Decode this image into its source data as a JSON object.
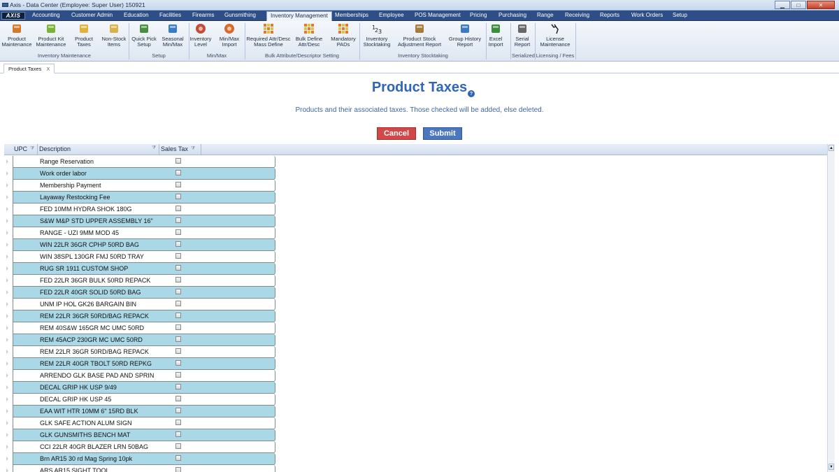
{
  "window": {
    "title": "Axis - Data Center  (Employee: Super User) 150921",
    "minimize_glyph": "▁",
    "maximize_glyph": "□",
    "close_glyph": "✕"
  },
  "menu": {
    "logo": "AXIS",
    "items": [
      "Accounting",
      "Customer Admin",
      "Education",
      "Facilities",
      "Firearms",
      "Gunsmithing",
      "Inventory Management",
      "Memberships",
      "Employee",
      "POS Management",
      "Pricing",
      "Purchasing",
      "Range",
      "Receiving",
      "Reports",
      "Work Orders",
      "Setup"
    ],
    "active": "Inventory Management"
  },
  "ribbon": {
    "buttons": [
      {
        "line1": "Product",
        "line2": "Maintenance",
        "icon": "box-icon"
      },
      {
        "line1": "Product Kit",
        "line2": "Maintenance",
        "icon": "puzzle-icon"
      },
      {
        "line1": "Product",
        "line2": "Taxes",
        "icon": "coins-icon"
      },
      {
        "line1": "Non-Stock",
        "line2": "Items",
        "icon": "package-icon"
      },
      {
        "line1": "Quick Pick",
        "line2": "Setup",
        "icon": "quickpick-icon"
      },
      {
        "line1": "Seasonal",
        "line2": "Min/Max",
        "icon": "seasonal-icon"
      },
      {
        "line1": "Inventory",
        "line2": "Level",
        "icon": "gauge-icon"
      },
      {
        "line1": "Min/Max",
        "line2": "Import",
        "icon": "import-icon"
      },
      {
        "line1": "Required Attr/Desc",
        "line2": "Mass Define",
        "icon": "grid-icon"
      },
      {
        "line1": "Bulk Define",
        "line2": "Attr/Desc",
        "icon": "grid-icon"
      },
      {
        "line1": "Mandatory",
        "line2": "PADs",
        "icon": "grid-icon"
      },
      {
        "line1": "Inventory",
        "line2": "Stocktaking",
        "icon": "numbers-icon"
      },
      {
        "line1": "Product Stock",
        "line2": "Adjustment Report",
        "icon": "clipboard-icon"
      },
      {
        "line1": "Group History",
        "line2": "Report",
        "icon": "download-icon"
      },
      {
        "line1": "Excel",
        "line2": "Import",
        "icon": "excel-icon"
      },
      {
        "line1": "Serial",
        "line2": "Report",
        "icon": "report-icon"
      },
      {
        "line1": "License",
        "line2": "Maintenance",
        "icon": "deer-icon"
      }
    ],
    "groups": [
      "Inventory Maintenance",
      "Setup",
      "Min/Max",
      "Bulk Attribute/Descriptor Setting",
      "Inventory Stocktaking",
      "Serialized",
      "Licensing / Fees"
    ]
  },
  "tab": {
    "label": "Product Taxes",
    "close": "X"
  },
  "page": {
    "title": "Product Taxes",
    "help": "?",
    "subtitle": "Products and their associated taxes.  Those checked will be added, else deleted.",
    "cancel": "Cancel",
    "submit": "Submit"
  },
  "grid": {
    "columns": [
      "UPC",
      "Description",
      "Sales Tax"
    ],
    "rows": [
      "Range Reservation",
      "Work order labor",
      "Membership Payment",
      "Layaway Restocking Fee",
      "FED 10MM HYDRA SHOK 180G",
      "S&W M&P STD UPPER ASSEMBLY 16\"",
      "RANGE - UZI 9MM MOD 45",
      "WIN 22LR 36GR CPHP 50RD BAG",
      "WIN 38SPL 130GR FMJ 50RD TRAY",
      "RUG SR 1911 CUSTOM SHOP",
      "FED 22LR 36GR BULK 50RD REPACK",
      "FED 22LR 40GR SOLID 50RD BAG",
      "UNM IP HOL GK26 BARGAIN BIN",
      "REM 22LR 36GR 50RD/BAG REPACK",
      "REM 40S&W 165GR MC UMC 50RD",
      "REM 45ACP 230GR MC UMC 50RD",
      "REM 22LR 36GR 50RD/BAG REPACK",
      "REM 22LR 40GR TBOLT 50RD REPKG",
      "ARRENDO GLK BASE PAD AND SPRIN",
      "DECAL GRIP HK USP 9/49",
      "DECAL GRIP HK USP 45",
      "EAA WIT HTR 10MM 6\" 15RD BLK",
      "GLK SAFE ACTION ALUM SIGN",
      "GLK GUNSMITHS BENCH MAT",
      "CCI 22LR 40GR BLAZER LRN 50BAG",
      "Brn AR15 30 rd Mag Spring 10pk",
      "ARS AR15 SIGHT TOOL"
    ]
  },
  "scroll": {
    "up": "▲",
    "down": "▼"
  },
  "colors": {
    "accent": "#3066b5",
    "cancel": "#d24848",
    "submit": "#4c77bf",
    "row_alt": "#abd8e6",
    "menubar": "#2d4e86"
  }
}
